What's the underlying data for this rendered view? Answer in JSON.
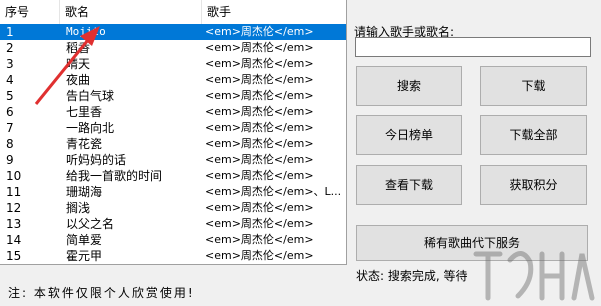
{
  "table": {
    "headers": [
      "序号",
      "歌名",
      "歌手"
    ],
    "rows": [
      {
        "no": "1",
        "song": "Mojito",
        "artist": "<em>周杰伦</em>"
      },
      {
        "no": "2",
        "song": "稻香",
        "artist": "<em>周杰伦</em>"
      },
      {
        "no": "3",
        "song": "晴天",
        "artist": "<em>周杰伦</em>"
      },
      {
        "no": "4",
        "song": "夜曲",
        "artist": "<em>周杰伦</em>"
      },
      {
        "no": "5",
        "song": "告白气球",
        "artist": "<em>周杰伦</em>"
      },
      {
        "no": "6",
        "song": "七里香",
        "artist": "<em>周杰伦</em>"
      },
      {
        "no": "7",
        "song": "一路向北",
        "artist": "<em>周杰伦</em>"
      },
      {
        "no": "8",
        "song": "青花瓷",
        "artist": "<em>周杰伦</em>"
      },
      {
        "no": "9",
        "song": "听妈妈的话",
        "artist": "<em>周杰伦</em>"
      },
      {
        "no": "10",
        "song": "给我一首歌的时间",
        "artist": "<em>周杰伦</em>"
      },
      {
        "no": "11",
        "song": "珊瑚海",
        "artist": "<em>周杰伦</em>、L..."
      },
      {
        "no": "12",
        "song": "搁浅",
        "artist": "<em>周杰伦</em>"
      },
      {
        "no": "13",
        "song": "以父之名",
        "artist": "<em>周杰伦</em>"
      },
      {
        "no": "14",
        "song": "简单爱",
        "artist": "<em>周杰伦</em>"
      },
      {
        "no": "15",
        "song": "霍元甲",
        "artist": "<em>周杰伦</em>"
      }
    ]
  },
  "note": "注:  本软件仅限个人欣赏使用!",
  "search": {
    "label": "请输入歌手或歌名:",
    "value": ""
  },
  "buttons": {
    "search": "搜索",
    "download": "下载",
    "today_chart": "今日榜单",
    "download_all": "下载全部",
    "view_download": "查看下载",
    "get_points": "获取积分",
    "rare_service": "稀有歌曲代下服务"
  },
  "status": "状态:  搜索完成, 等待",
  "colors": {
    "selection": "#0078d7",
    "arrow": "#e03030",
    "window": "#f0f0f0"
  }
}
